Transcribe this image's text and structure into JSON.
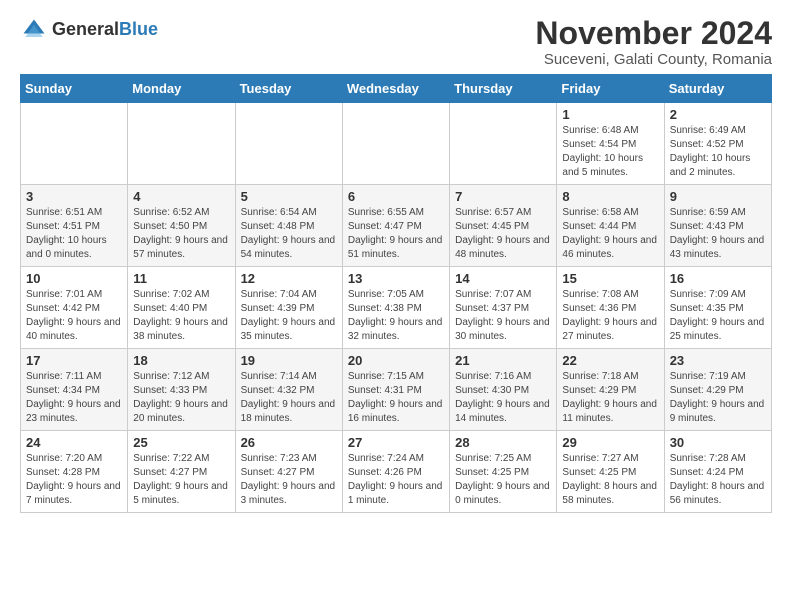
{
  "logo": {
    "general": "General",
    "blue": "Blue"
  },
  "title": "November 2024",
  "subtitle": "Suceveni, Galati County, Romania",
  "days_header": [
    "Sunday",
    "Monday",
    "Tuesday",
    "Wednesday",
    "Thursday",
    "Friday",
    "Saturday"
  ],
  "weeks": [
    [
      {
        "day": "",
        "info": ""
      },
      {
        "day": "",
        "info": ""
      },
      {
        "day": "",
        "info": ""
      },
      {
        "day": "",
        "info": ""
      },
      {
        "day": "",
        "info": ""
      },
      {
        "day": "1",
        "info": "Sunrise: 6:48 AM\nSunset: 4:54 PM\nDaylight: 10 hours and 5 minutes."
      },
      {
        "day": "2",
        "info": "Sunrise: 6:49 AM\nSunset: 4:52 PM\nDaylight: 10 hours and 2 minutes."
      }
    ],
    [
      {
        "day": "3",
        "info": "Sunrise: 6:51 AM\nSunset: 4:51 PM\nDaylight: 10 hours and 0 minutes."
      },
      {
        "day": "4",
        "info": "Sunrise: 6:52 AM\nSunset: 4:50 PM\nDaylight: 9 hours and 57 minutes."
      },
      {
        "day": "5",
        "info": "Sunrise: 6:54 AM\nSunset: 4:48 PM\nDaylight: 9 hours and 54 minutes."
      },
      {
        "day": "6",
        "info": "Sunrise: 6:55 AM\nSunset: 4:47 PM\nDaylight: 9 hours and 51 minutes."
      },
      {
        "day": "7",
        "info": "Sunrise: 6:57 AM\nSunset: 4:45 PM\nDaylight: 9 hours and 48 minutes."
      },
      {
        "day": "8",
        "info": "Sunrise: 6:58 AM\nSunset: 4:44 PM\nDaylight: 9 hours and 46 minutes."
      },
      {
        "day": "9",
        "info": "Sunrise: 6:59 AM\nSunset: 4:43 PM\nDaylight: 9 hours and 43 minutes."
      }
    ],
    [
      {
        "day": "10",
        "info": "Sunrise: 7:01 AM\nSunset: 4:42 PM\nDaylight: 9 hours and 40 minutes."
      },
      {
        "day": "11",
        "info": "Sunrise: 7:02 AM\nSunset: 4:40 PM\nDaylight: 9 hours and 38 minutes."
      },
      {
        "day": "12",
        "info": "Sunrise: 7:04 AM\nSunset: 4:39 PM\nDaylight: 9 hours and 35 minutes."
      },
      {
        "day": "13",
        "info": "Sunrise: 7:05 AM\nSunset: 4:38 PM\nDaylight: 9 hours and 32 minutes."
      },
      {
        "day": "14",
        "info": "Sunrise: 7:07 AM\nSunset: 4:37 PM\nDaylight: 9 hours and 30 minutes."
      },
      {
        "day": "15",
        "info": "Sunrise: 7:08 AM\nSunset: 4:36 PM\nDaylight: 9 hours and 27 minutes."
      },
      {
        "day": "16",
        "info": "Sunrise: 7:09 AM\nSunset: 4:35 PM\nDaylight: 9 hours and 25 minutes."
      }
    ],
    [
      {
        "day": "17",
        "info": "Sunrise: 7:11 AM\nSunset: 4:34 PM\nDaylight: 9 hours and 23 minutes."
      },
      {
        "day": "18",
        "info": "Sunrise: 7:12 AM\nSunset: 4:33 PM\nDaylight: 9 hours and 20 minutes."
      },
      {
        "day": "19",
        "info": "Sunrise: 7:14 AM\nSunset: 4:32 PM\nDaylight: 9 hours and 18 minutes."
      },
      {
        "day": "20",
        "info": "Sunrise: 7:15 AM\nSunset: 4:31 PM\nDaylight: 9 hours and 16 minutes."
      },
      {
        "day": "21",
        "info": "Sunrise: 7:16 AM\nSunset: 4:30 PM\nDaylight: 9 hours and 14 minutes."
      },
      {
        "day": "22",
        "info": "Sunrise: 7:18 AM\nSunset: 4:29 PM\nDaylight: 9 hours and 11 minutes."
      },
      {
        "day": "23",
        "info": "Sunrise: 7:19 AM\nSunset: 4:29 PM\nDaylight: 9 hours and 9 minutes."
      }
    ],
    [
      {
        "day": "24",
        "info": "Sunrise: 7:20 AM\nSunset: 4:28 PM\nDaylight: 9 hours and 7 minutes."
      },
      {
        "day": "25",
        "info": "Sunrise: 7:22 AM\nSunset: 4:27 PM\nDaylight: 9 hours and 5 minutes."
      },
      {
        "day": "26",
        "info": "Sunrise: 7:23 AM\nSunset: 4:27 PM\nDaylight: 9 hours and 3 minutes."
      },
      {
        "day": "27",
        "info": "Sunrise: 7:24 AM\nSunset: 4:26 PM\nDaylight: 9 hours and 1 minute."
      },
      {
        "day": "28",
        "info": "Sunrise: 7:25 AM\nSunset: 4:25 PM\nDaylight: 9 hours and 0 minutes."
      },
      {
        "day": "29",
        "info": "Sunrise: 7:27 AM\nSunset: 4:25 PM\nDaylight: 8 hours and 58 minutes."
      },
      {
        "day": "30",
        "info": "Sunrise: 7:28 AM\nSunset: 4:24 PM\nDaylight: 8 hours and 56 minutes."
      }
    ]
  ]
}
